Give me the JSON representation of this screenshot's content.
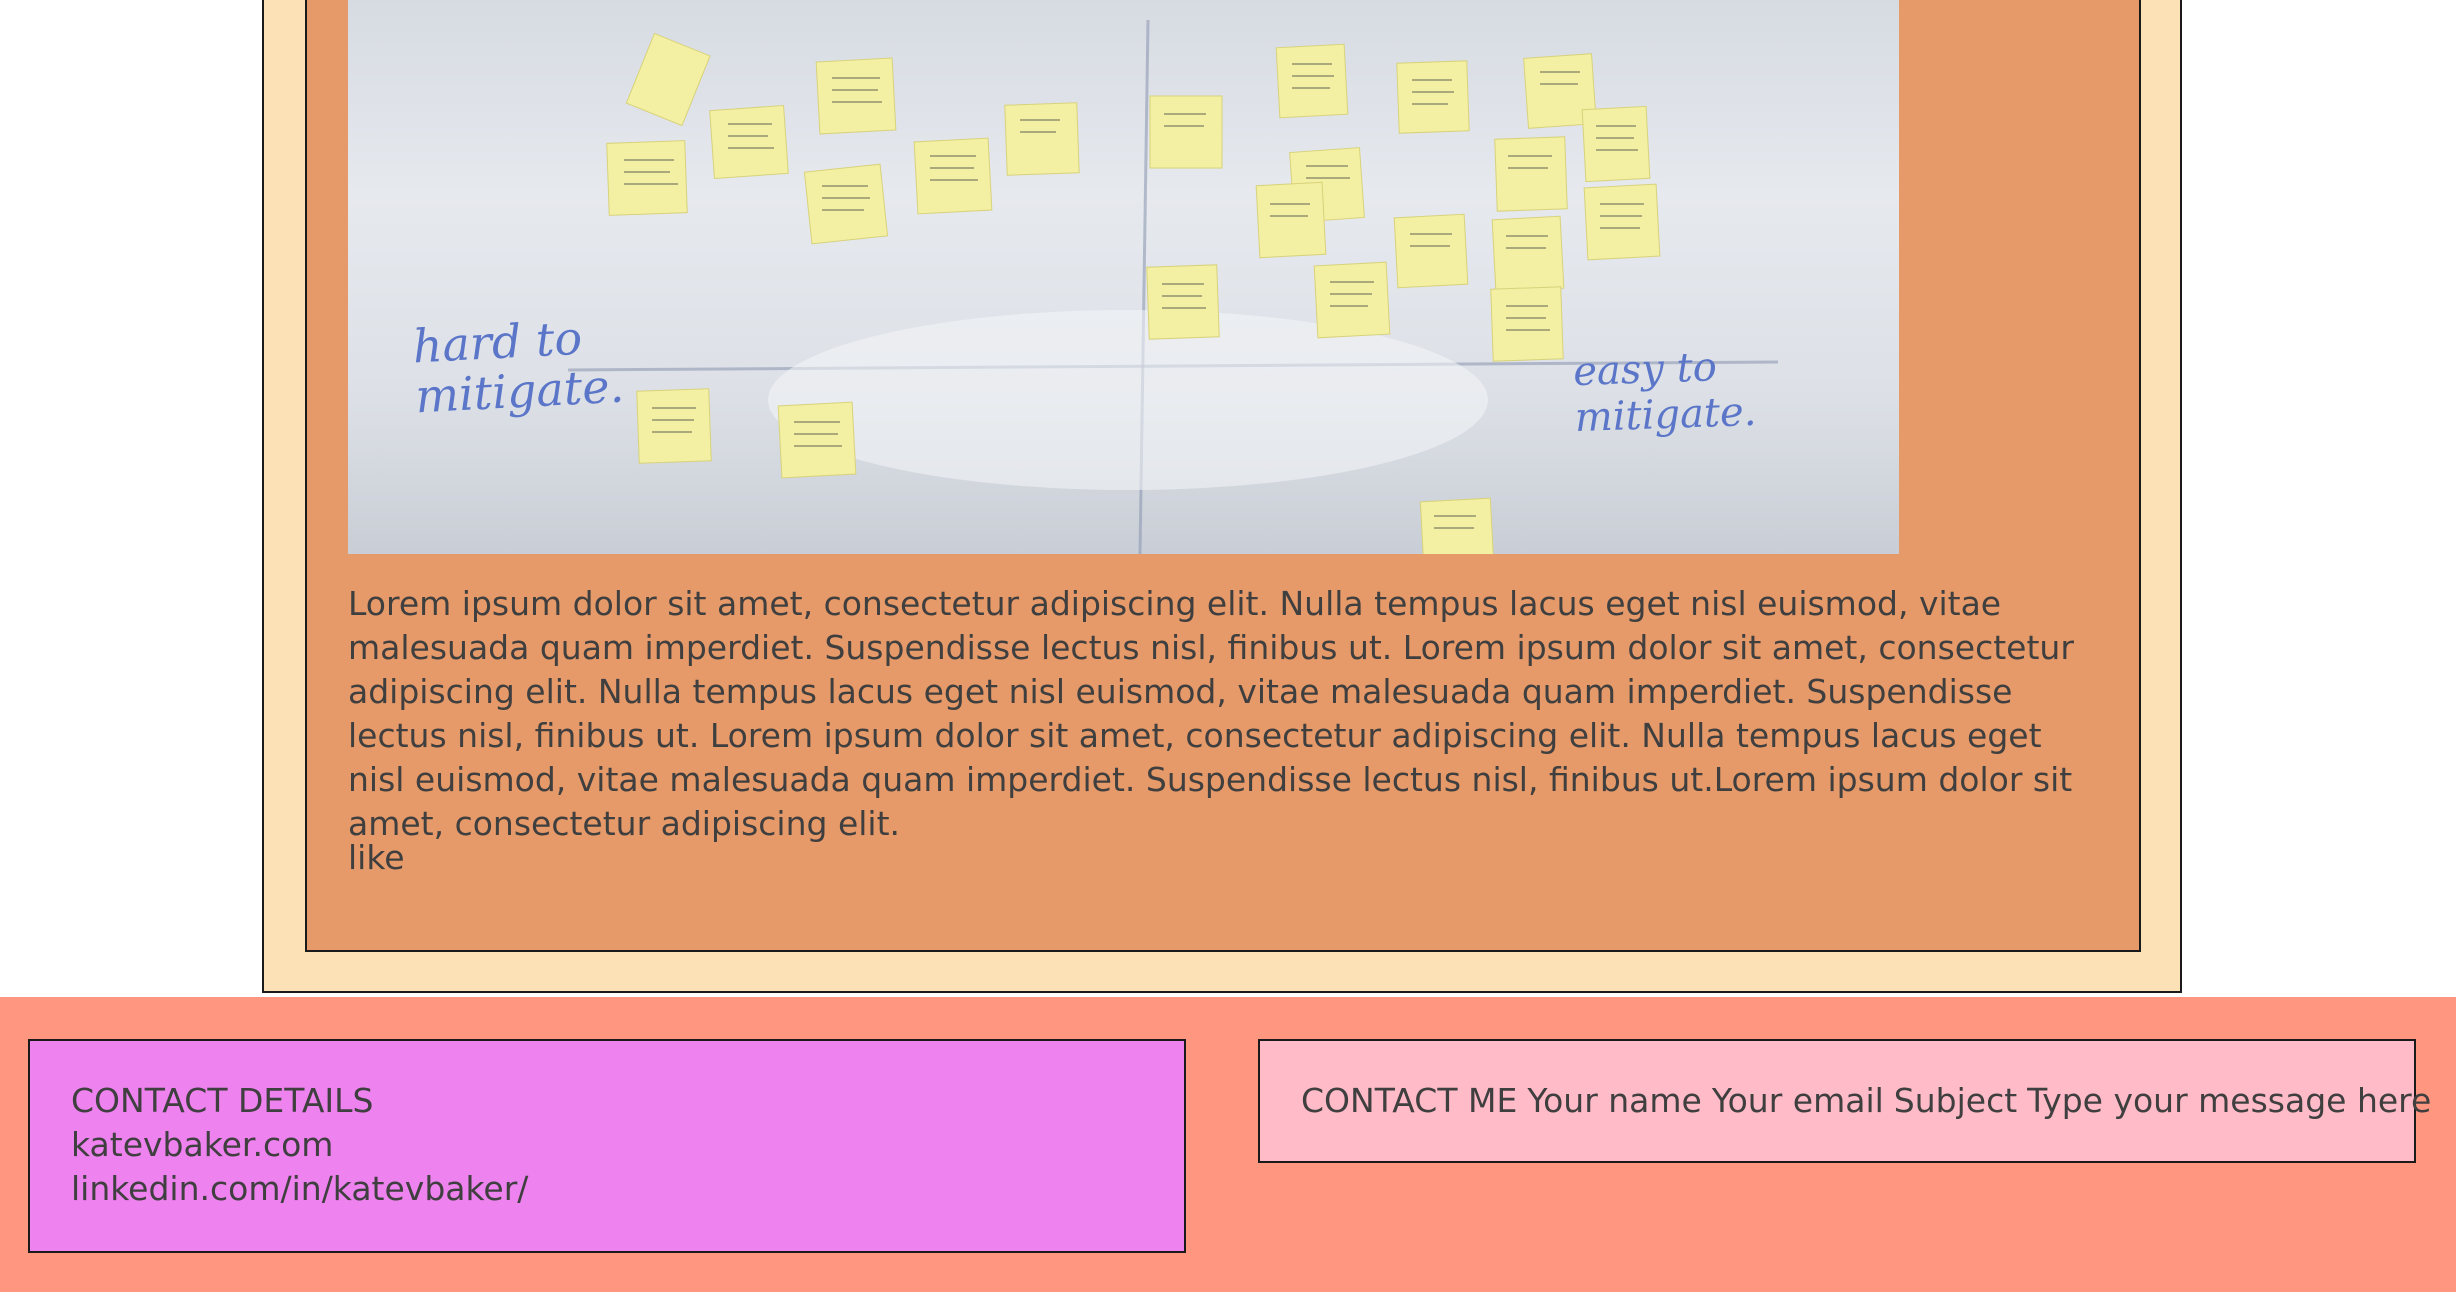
{
  "article": {
    "image_alt": "Whiteboard with sticky notes on a risk mitigation axis",
    "whiteboard_labels": {
      "left_axis": [
        "hard to",
        "mitigate."
      ],
      "right_axis": [
        "easy to",
        "mitigate."
      ]
    },
    "body": "Lorem ipsum dolor sit amet, consectetur adipiscing elit. Nulla tempus lacus eget nisl euismod, vitae malesuada quam imperdiet. Suspendisse lectus nisl, finibus ut. Lorem ipsum dolor sit amet, consectetur adipiscing elit. Nulla tempus lacus eget nisl euismod, vitae malesuada quam imperdiet. Suspendisse lectus nisl, finibus ut. Lorem ipsum dolor sit amet, consectetur adipiscing elit. Nulla tempus lacus eget nisl euismod, vitae malesuada quam imperdiet. Suspendisse lectus nisl, finibus ut.Lorem ipsum dolor sit amet, consectetur adipiscing elit.",
    "like_label": "like"
  },
  "footer": {
    "contact_details": {
      "heading": "CONTACT DETAILS",
      "website": "katevbaker.com",
      "linkedin": "linkedin.com/in/katevbaker/"
    },
    "contact_form": {
      "heading": "CONTACT ME",
      "name_placeholder": "Your name",
      "email_placeholder": "Your email",
      "subject_placeholder": "Subject",
      "message_placeholder": "Type your message here"
    }
  },
  "colors": {
    "page_background": "#ffffff",
    "frame": "#fde1b6",
    "article_card": "#e79a69",
    "footer": "#fe9680",
    "contact_details_box": "#ee82ee",
    "contact_form_box": "#ffbbc8",
    "sticky_note": "#f3f0a4",
    "marker_ink": "#5b76c8"
  }
}
